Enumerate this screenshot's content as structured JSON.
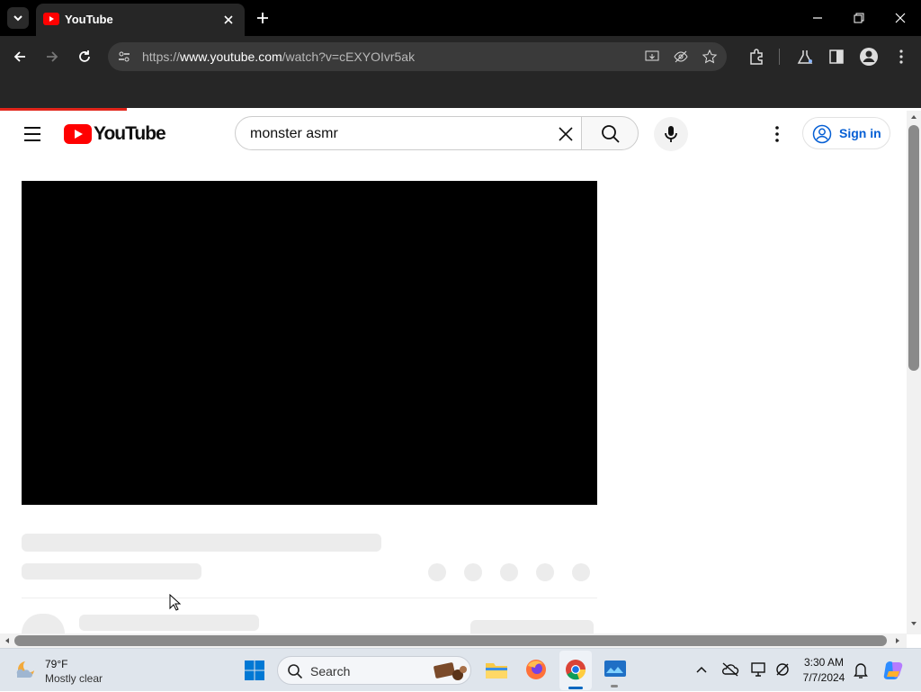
{
  "browser": {
    "tab_title": "YouTube",
    "url_prefix": "https://",
    "url_host": "www.youtube.com",
    "url_path": "/watch?v=cEXYOIvr5ak"
  },
  "youtube": {
    "logo_text": "YouTube",
    "search_value": "monster asmr",
    "sign_in_label": "Sign in"
  },
  "taskbar": {
    "weather_temp": "79°F",
    "weather_condition": "Mostly clear",
    "search_placeholder": "Search",
    "time": "3:30 AM",
    "date": "7/7/2024"
  },
  "colors": {
    "youtube_red": "#ff0000",
    "link_blue": "#065fd4",
    "progress_red": "#e1251b"
  }
}
